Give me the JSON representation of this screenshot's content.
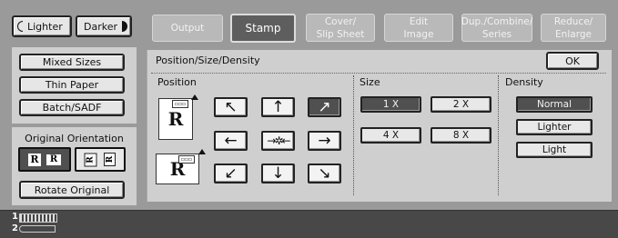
{
  "left": {
    "lighter_label": "Lighter",
    "darker_label": "Darker",
    "mixed_sizes": "Mixed Sizes",
    "thin_paper": "Thin Paper",
    "batch_sadf": "Batch/SADF",
    "orientation_title": "Original Orientation",
    "rotate_original": "Rotate Original"
  },
  "tabs": [
    {
      "line1": "Output",
      "line2": ""
    },
    {
      "line1": "Stamp",
      "line2": ""
    },
    {
      "line1": "Cover/",
      "line2": "Slip Sheet"
    },
    {
      "line1": "Edit",
      "line2": "Image"
    },
    {
      "line1": "Dup./Combine/",
      "line2": "Series"
    },
    {
      "line1": "Reduce/",
      "line2": "Enlarge"
    }
  ],
  "panel": {
    "title": "Position/Size/Density",
    "ok": "OK",
    "position_label": "Position",
    "size_label": "Size",
    "density_label": "Density",
    "sizes": [
      "1 X",
      "2 X",
      "4 X",
      "8 X"
    ],
    "selected_size": "1 X",
    "densities": [
      "Normal",
      "Lighter",
      "Light"
    ],
    "selected_density": "Normal",
    "selected_position": "top-right"
  },
  "status": {
    "line1": "1",
    "line2": "2"
  },
  "colors": {
    "background": "#9a9a9a",
    "selected": "#505050",
    "status_bar": "#484848"
  }
}
